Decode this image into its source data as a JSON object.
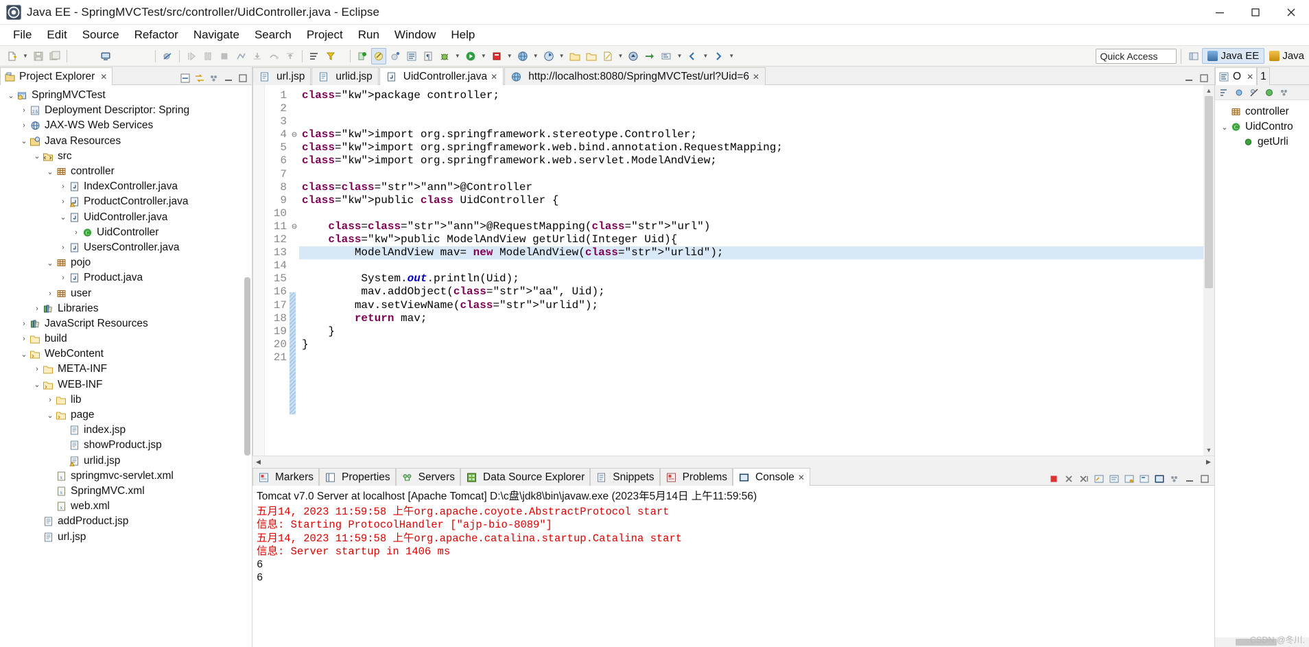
{
  "window": {
    "title": "Java EE - SpringMVCTest/src/controller/UidController.java - Eclipse",
    "icon": "eclipse-icon",
    "minimize": "minimize-icon",
    "maximize": "maximize-icon",
    "close": "close-icon"
  },
  "menubar": {
    "items": [
      "File",
      "Edit",
      "Source",
      "Refactor",
      "Navigate",
      "Search",
      "Project",
      "Run",
      "Window",
      "Help"
    ]
  },
  "toolbar": {
    "quick_access_placeholder": "Quick Access",
    "perspectives": [
      {
        "label": "Java EE",
        "active": true
      },
      {
        "label": "Java",
        "active": false
      }
    ]
  },
  "project_explorer": {
    "tab_label": "Project Explorer",
    "tab_icon": "project-explorer-icon",
    "close_icon": "close-icon",
    "tools": [
      "collapse-all-icon",
      "link-with-editor-icon",
      "view-menu-icon",
      "minimize-icon",
      "maximize-icon"
    ],
    "tree": [
      {
        "label": "SpringMVCTest",
        "indent": 0,
        "arrow": "down",
        "icon": "project-icon"
      },
      {
        "label": "Deployment Descriptor: Spring",
        "indent": 1,
        "arrow": "right",
        "icon": "deployment-descriptor-icon"
      },
      {
        "label": "JAX-WS Web Services",
        "indent": 1,
        "arrow": "right",
        "icon": "webservice-icon"
      },
      {
        "label": "Java Resources",
        "indent": 1,
        "arrow": "down",
        "icon": "java-resources-icon"
      },
      {
        "label": "src",
        "indent": 2,
        "arrow": "down",
        "icon": "source-folder-icon"
      },
      {
        "label": "controller",
        "indent": 3,
        "arrow": "down",
        "icon": "package-icon"
      },
      {
        "label": "IndexController.java",
        "indent": 4,
        "arrow": "right",
        "icon": "java-file-icon"
      },
      {
        "label": "ProductController.java",
        "indent": 4,
        "arrow": "right",
        "icon": "java-file-warning-icon"
      },
      {
        "label": "UidController.java",
        "indent": 4,
        "arrow": "down",
        "icon": "java-file-icon"
      },
      {
        "label": "UidController",
        "indent": 5,
        "arrow": "right",
        "icon": "java-class-icon"
      },
      {
        "label": "UsersController.java",
        "indent": 4,
        "arrow": "right",
        "icon": "java-file-icon"
      },
      {
        "label": "pojo",
        "indent": 3,
        "arrow": "down",
        "icon": "package-icon"
      },
      {
        "label": "Product.java",
        "indent": 4,
        "arrow": "right",
        "icon": "java-file-icon"
      },
      {
        "label": "user",
        "indent": 3,
        "arrow": "right",
        "icon": "package-icon"
      },
      {
        "label": "Libraries",
        "indent": 2,
        "arrow": "right",
        "icon": "libraries-icon"
      },
      {
        "label": "JavaScript Resources",
        "indent": 1,
        "arrow": "right",
        "icon": "libraries-icon"
      },
      {
        "label": "build",
        "indent": 1,
        "arrow": "right",
        "icon": "folder-icon"
      },
      {
        "label": "WebContent",
        "indent": 1,
        "arrow": "down",
        "icon": "webcontent-folder-icon"
      },
      {
        "label": "META-INF",
        "indent": 2,
        "arrow": "right",
        "icon": "folder-icon"
      },
      {
        "label": "WEB-INF",
        "indent": 2,
        "arrow": "down",
        "icon": "webcontent-folder-icon"
      },
      {
        "label": "lib",
        "indent": 3,
        "arrow": "right",
        "icon": "folder-icon"
      },
      {
        "label": "page",
        "indent": 3,
        "arrow": "down",
        "icon": "webcontent-folder-icon"
      },
      {
        "label": "index.jsp",
        "indent": 4,
        "arrow": "none",
        "icon": "jsp-file-icon"
      },
      {
        "label": "showProduct.jsp",
        "indent": 4,
        "arrow": "none",
        "icon": "jsp-file-icon"
      },
      {
        "label": "urlid.jsp",
        "indent": 4,
        "arrow": "none",
        "icon": "jsp-file-warning-icon"
      },
      {
        "label": "springmvc-servlet.xml",
        "indent": 3,
        "arrow": "none",
        "icon": "xml-file-icon"
      },
      {
        "label": "SpringMVC.xml",
        "indent": 3,
        "arrow": "none",
        "icon": "xml-file-icon"
      },
      {
        "label": "web.xml",
        "indent": 3,
        "arrow": "none",
        "icon": "xml-file-icon"
      },
      {
        "label": "addProduct.jsp",
        "indent": 2,
        "arrow": "none",
        "icon": "jsp-file-icon"
      },
      {
        "label": "url.jsp",
        "indent": 2,
        "arrow": "none",
        "icon": "jsp-file-icon"
      }
    ]
  },
  "editor": {
    "tabs": [
      {
        "label": "url.jsp",
        "icon": "jsp-file-icon",
        "active": false,
        "closeable": false
      },
      {
        "label": "urlid.jsp",
        "icon": "jsp-file-icon",
        "active": false,
        "closeable": false
      },
      {
        "label": "UidController.java",
        "icon": "java-file-icon",
        "active": true,
        "closeable": true
      },
      {
        "label": "http://localhost:8080/SpringMVCTest/url?Uid=6",
        "icon": "browser-icon",
        "active": false,
        "closeable": true
      }
    ],
    "close_icon": "close-icon",
    "first_line": 1,
    "last_line": 21,
    "highlighted_line": 13,
    "lines": [
      {
        "n": 1,
        "fold": "",
        "text": "package controller;"
      },
      {
        "n": 2,
        "fold": "",
        "text": ""
      },
      {
        "n": 3,
        "fold": "",
        "text": ""
      },
      {
        "n": 4,
        "fold": "-",
        "text": "import org.springframework.stereotype.Controller;"
      },
      {
        "n": 5,
        "fold": "",
        "text": "import org.springframework.web.bind.annotation.RequestMapping;"
      },
      {
        "n": 6,
        "fold": "",
        "text": "import org.springframework.web.servlet.ModelAndView;"
      },
      {
        "n": 7,
        "fold": "",
        "text": ""
      },
      {
        "n": 8,
        "fold": "",
        "text": "@Controller"
      },
      {
        "n": 9,
        "fold": "",
        "text": "public class UidController {"
      },
      {
        "n": 10,
        "fold": "",
        "text": ""
      },
      {
        "n": 11,
        "fold": "-",
        "text": "    @RequestMapping(\"url\")"
      },
      {
        "n": 12,
        "fold": "",
        "text": "    public ModelAndView getUrlid(Integer Uid){"
      },
      {
        "n": 13,
        "fold": "",
        "text": "        ModelAndView mav= new ModelAndView(\"urlid\");"
      },
      {
        "n": 14,
        "fold": "",
        "text": ""
      },
      {
        "n": 15,
        "fold": "",
        "text": "         System.out.println(Uid);"
      },
      {
        "n": 16,
        "fold": "",
        "text": "         mav.addObject(\"aa\", Uid);"
      },
      {
        "n": 17,
        "fold": "",
        "text": "        mav.setViewName(\"urlid\");"
      },
      {
        "n": 18,
        "fold": "",
        "text": "        return mav;"
      },
      {
        "n": 19,
        "fold": "",
        "text": "    }"
      },
      {
        "n": 20,
        "fold": "",
        "text": "}"
      },
      {
        "n": 21,
        "fold": "",
        "text": ""
      }
    ]
  },
  "bottom_panel": {
    "tabs": [
      {
        "label": "Markers",
        "icon": "markers-icon",
        "active": false
      },
      {
        "label": "Properties",
        "icon": "properties-icon",
        "active": false
      },
      {
        "label": "Servers",
        "icon": "servers-icon",
        "active": false
      },
      {
        "label": "Data Source Explorer",
        "icon": "data-source-explorer-icon",
        "active": false
      },
      {
        "label": "Snippets",
        "icon": "snippets-icon",
        "active": false
      },
      {
        "label": "Problems",
        "icon": "problems-icon",
        "active": false
      },
      {
        "label": "Console",
        "icon": "console-icon",
        "active": true
      }
    ],
    "close_icon": "close-icon",
    "tools": [
      "terminate-icon",
      "remove-launch-icon",
      "remove-all-icon",
      "clear-console-icon",
      "scroll-lock-icon",
      "pin-console-icon",
      "display-selected-console-icon",
      "open-console-icon",
      "view-menu-icon",
      "minimize-icon",
      "maximize-icon"
    ],
    "console_title": "Tomcat v7.0 Server at localhost [Apache Tomcat] D:\\c盘\\jdk8\\bin\\javaw.exe (2023年5月14日 上午11:59:56)",
    "console_lines": [
      {
        "text": "五月14, 2023 11:59:58 上午org.apache.coyote.AbstractProtocol start",
        "color": "red"
      },
      {
        "text": "信息: Starting ProtocolHandler [\"ajp-bio-8089\"]",
        "color": "red"
      },
      {
        "text": "五月14, 2023 11:59:58 上午org.apache.catalina.startup.Catalina start",
        "color": "red"
      },
      {
        "text": "信息: Server startup in 1406 ms",
        "color": "red"
      },
      {
        "text": "6",
        "color": "black"
      },
      {
        "text": "6",
        "color": "black"
      }
    ]
  },
  "outline": {
    "tab_label": "O",
    "tab_icon": "outline-icon",
    "close_icon": "close-icon",
    "second_tab_label": "1",
    "tools": [
      "sort-icon",
      "hide-fields-icon",
      "hide-static-icon",
      "hide-nonpublic-icon",
      "view-menu-icon"
    ],
    "items": [
      {
        "label": "controller",
        "indent": 0,
        "arrow": "none",
        "icon": "package-icon"
      },
      {
        "label": "UidContro",
        "indent": 0,
        "arrow": "down",
        "icon": "java-class-icon"
      },
      {
        "label": "getUrli",
        "indent": 1,
        "arrow": "none",
        "icon": "method-icon"
      }
    ]
  },
  "watermark": "CSDN @冬川."
}
